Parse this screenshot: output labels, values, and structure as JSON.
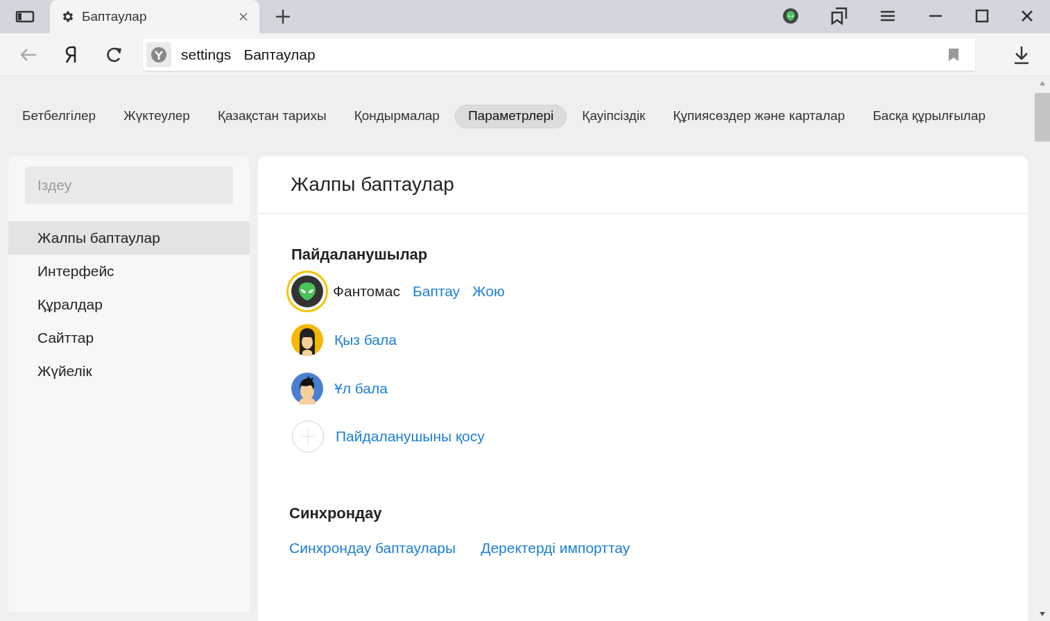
{
  "browser": {
    "tabs": [
      {
        "title": "Баптаулар",
        "selected": true
      }
    ],
    "address": {
      "scheme": "settings",
      "page": "Баптаулар"
    }
  },
  "nav": [
    {
      "label": "Бетбелгілер",
      "selected": false
    },
    {
      "label": "Жүктеулер",
      "selected": false
    },
    {
      "label": "Қазақстан тарихы",
      "selected": false
    },
    {
      "label": "Қондырмалар",
      "selected": false
    },
    {
      "label": "Параметрлері",
      "selected": true
    },
    {
      "label": "Қауіпсіздік",
      "selected": false
    },
    {
      "label": "Құпиясөздер және карталар",
      "selected": false
    },
    {
      "label": "Басқа құрылғылар",
      "selected": false
    }
  ],
  "sidebar": {
    "search": {
      "placeholder": "Іздеу"
    },
    "items": [
      {
        "label": "Жалпы баптаулар",
        "selected": true
      },
      {
        "label": "Интерфейс",
        "selected": false
      },
      {
        "label": "Құралдар",
        "selected": false
      },
      {
        "label": "Сайттар",
        "selected": false
      },
      {
        "label": "Жүйелік",
        "selected": false
      }
    ]
  },
  "main": {
    "title": "Жалпы баптаулар",
    "users": {
      "title": "Пайдаланушылар",
      "items": [
        {
          "name": "Фантомас",
          "kind": "alien",
          "current": true,
          "actions": [
            "Баптау",
            "Жою"
          ]
        },
        {
          "name": "Қыз бала",
          "kind": "girl",
          "current": false
        },
        {
          "name": "Ұл бала",
          "kind": "boy",
          "current": false
        }
      ],
      "add": "Пайдаланушыны қосу"
    },
    "sync": {
      "title": "Синхрондау",
      "links": [
        "Синхрондау баптаулары",
        "Деректерді импорттау"
      ]
    }
  }
}
